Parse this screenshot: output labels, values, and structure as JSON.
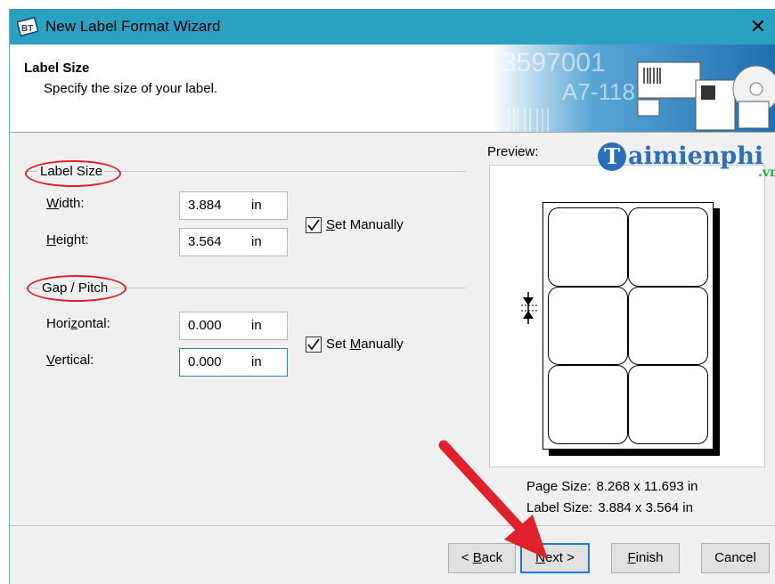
{
  "window": {
    "title": "New Label Format Wizard",
    "close_glyph": "✕",
    "app_icon": "bartender-app-icon"
  },
  "header": {
    "title": "Label Size",
    "subtitle": "Specify the size of your label.",
    "art_text_1": "3597001",
    "art_text_2": "A7-118"
  },
  "label_size_group": {
    "title": "Label Size",
    "width_label_pre": "",
    "width_label_u": "W",
    "width_label_post": "idth:",
    "width_value": "3.884",
    "width_unit": "in",
    "height_label_pre": "",
    "height_label_u": "H",
    "height_label_post": "eight:",
    "height_value": "3.564",
    "height_unit": "in",
    "set_manually_pre": "",
    "set_manually_u": "S",
    "set_manually_post": "et Manually",
    "set_manually_checked": true
  },
  "gap_group": {
    "title": "Gap / Pitch",
    "horizontal_label_pre": "Hori",
    "horizontal_label_u": "z",
    "horizontal_label_post": "ontal:",
    "horizontal_value": "0.000",
    "horizontal_unit": "in",
    "vertical_label_pre": "",
    "vertical_label_u": "V",
    "vertical_label_post": "ertical:",
    "vertical_value": "0.000",
    "vertical_unit": "in",
    "set_manually_pre": "Set ",
    "set_manually_u": "M",
    "set_manually_post": "anually",
    "set_manually_checked": true
  },
  "preview": {
    "label": "Preview:",
    "rows": 3,
    "cols": 2,
    "page_size_label": "Page Size:",
    "page_size_value": "8.268 x 11.693 in",
    "label_size_label": "Label Size:",
    "label_size_value": "3.884 x 3.564 in"
  },
  "buttons": {
    "back_pre": "< ",
    "back_u": "B",
    "back_post": "ack",
    "next_u": "N",
    "next_post": "ext >",
    "finish_u": "F",
    "finish_post": "inish",
    "cancel": "Cancel"
  },
  "watermark": {
    "logo_letter": "T",
    "name": "aimienphi",
    "tld": ".vn"
  },
  "annotation_color": "#e0202a",
  "titlebar_color": "#2aa1c0"
}
